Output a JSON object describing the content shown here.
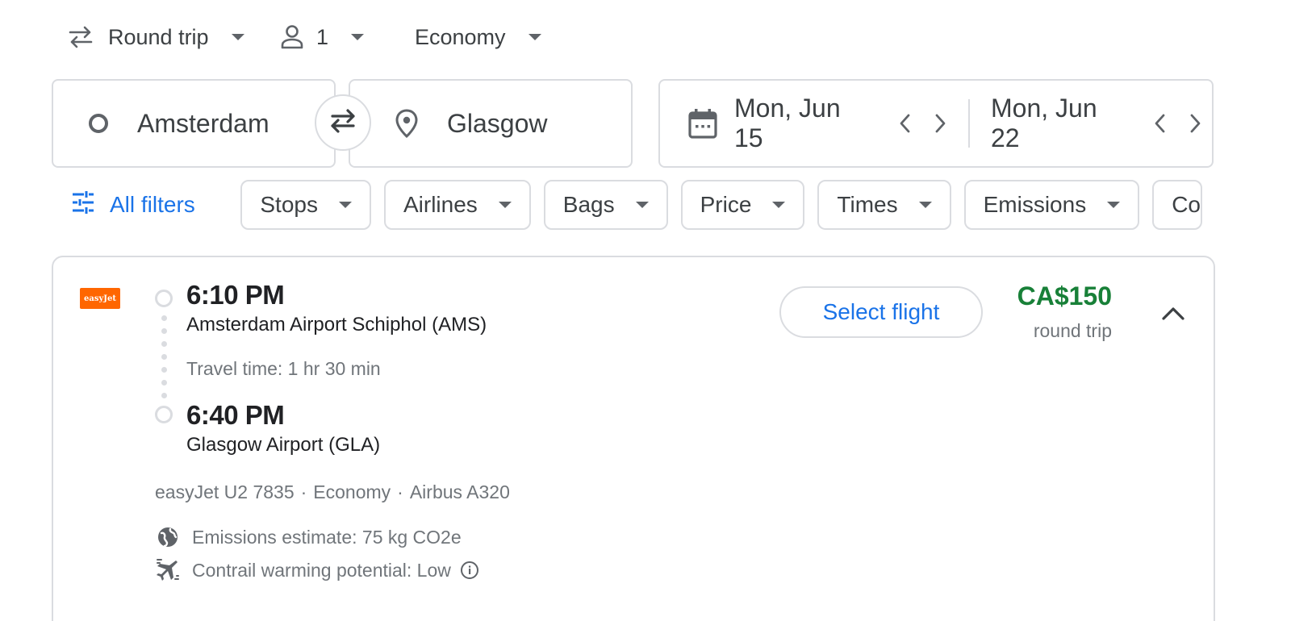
{
  "top_selectors": {
    "trip_type": "Round trip",
    "passengers": "1",
    "cabin": "Economy"
  },
  "search": {
    "origin": "Amsterdam",
    "destination": "Glasgow",
    "depart_date": "Mon, Jun 15",
    "return_date": "Mon, Jun 22"
  },
  "filters": {
    "all_filters": "All filters",
    "chips": [
      "Stops",
      "Airlines",
      "Bags",
      "Price",
      "Times",
      "Emissions",
      "Co"
    ]
  },
  "flight": {
    "airline_logo_text": "easyJet",
    "departure_time": "6:10 PM",
    "departure_airport": "Amsterdam Airport Schiphol (AMS)",
    "travel_time": "Travel time: 1 hr 30 min",
    "arrival_time": "6:40 PM",
    "arrival_airport": "Glasgow Airport (GLA)",
    "select_label": "Select flight",
    "price": "CA$150",
    "price_note": "round trip",
    "details": [
      "easyJet U2 7835",
      "Economy",
      "Airbus A320"
    ],
    "emissions": "Emissions estimate: 75 kg CO2e",
    "contrail": "Contrail warming potential: Low"
  },
  "colors": {
    "accent": "#1a73e8",
    "price_green": "#188038",
    "easyjet_orange": "#ff6600",
    "border": "#dadce0"
  },
  "icons": [
    "swap-horiz-icon",
    "person-icon",
    "circle-origin-icon",
    "swap-icon",
    "location-pin-icon",
    "calendar-icon",
    "chevron-left-icon",
    "chevron-right-icon",
    "tune-icon",
    "chevron-up-icon",
    "globe-icon",
    "contrail-plane-icon",
    "info-icon"
  ]
}
